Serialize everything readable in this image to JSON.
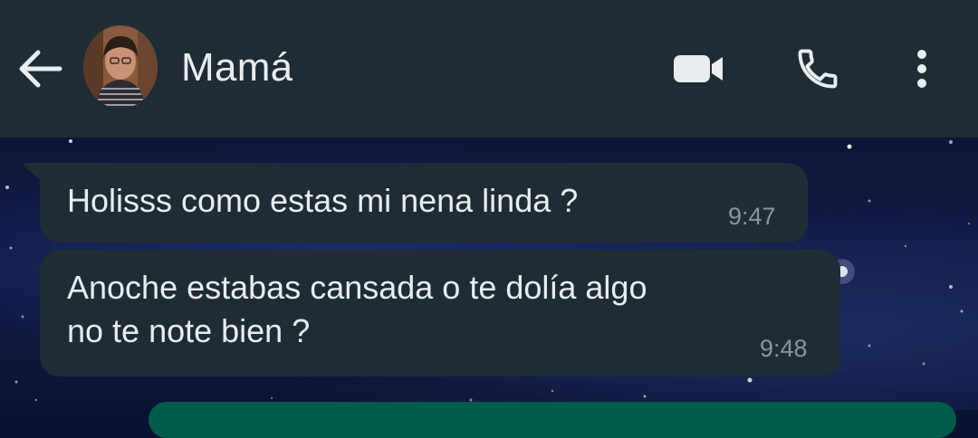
{
  "header": {
    "contact_name": "Mamá",
    "icons": [
      "back-arrow-icon",
      "video-camera-icon",
      "phone-icon",
      "more-vertical-icon"
    ]
  },
  "messages": [
    {
      "direction": "incoming",
      "text": "Holisss como estas mi nena linda ?",
      "time": "9:47"
    },
    {
      "direction": "incoming",
      "lines": [
        "Anoche estabas cansada o te dolía algo",
        "no te note bien ?"
      ],
      "time": "9:48"
    }
  ],
  "colors": {
    "header_bg": "#1f2c34",
    "incoming_bubble": "#1f2c34",
    "outgoing_bubble": "#005c4b",
    "text_primary": "#e9edef",
    "text_secondary": "#8696a0"
  }
}
